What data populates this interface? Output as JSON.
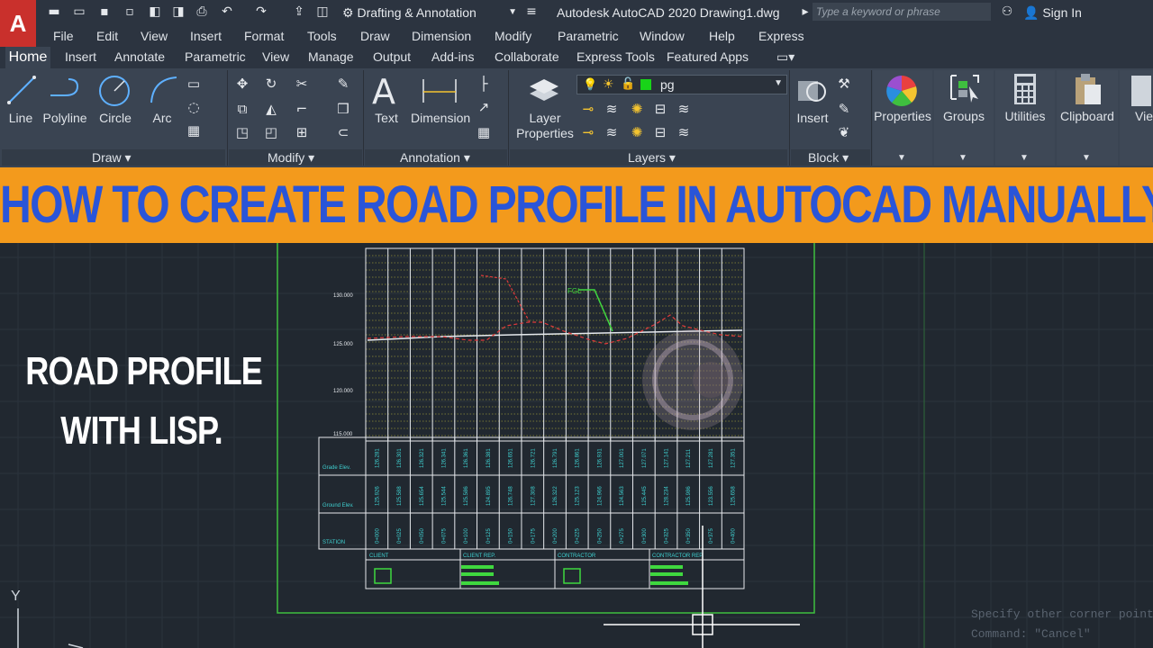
{
  "titlebar": {
    "app_logo": "A",
    "workspace": "Drafting & Annotation",
    "app_title": "Autodesk AutoCAD 2020    Drawing1.dwg",
    "search_placeholder": "Type a keyword or phrase",
    "sign_in": "Sign In"
  },
  "menu": [
    "File",
    "Edit",
    "View",
    "Insert",
    "Format",
    "Tools",
    "Draw",
    "Dimension",
    "Modify",
    "Parametric",
    "Window",
    "Help",
    "Express"
  ],
  "tabs": [
    "Home",
    "Insert",
    "Annotate",
    "Parametric",
    "View",
    "Manage",
    "Output",
    "Add-ins",
    "Collaborate",
    "Express Tools",
    "Featured Apps"
  ],
  "ribbon": {
    "draw_tools": [
      "Line",
      "Polyline",
      "Circle",
      "Arc"
    ],
    "panels": {
      "draw": "Draw",
      "modify": "Modify",
      "annotation": "Annotation",
      "layers": "Layers",
      "block": "Block"
    },
    "annotation_tools": [
      "Text",
      "Dimension"
    ],
    "layer_properties": "Layer\nProperties",
    "layer_current": "pg",
    "insert": "Insert",
    "right_tools": [
      "Properties",
      "Groups",
      "Utilities",
      "Clipboard",
      "Vie"
    ]
  },
  "banner": "HOW TO CREATE ROAD PROFILE IN AUTOCAD MANUALLY?",
  "overlay": {
    "line1": "ROAD PROFILE",
    "line2": "WITH LISP."
  },
  "drawing": {
    "elevations": [
      "130.000",
      "125.000",
      "120.000",
      "115.000"
    ],
    "row_labels": [
      "Grade Elev.",
      "Ground Elev.",
      "STATION"
    ],
    "footer_labels": [
      "CLIENT",
      "CLIENT REP.",
      "CONTRACTOR",
      "CONTRACTOR REP."
    ],
    "fgl_label": "FGL",
    "stations": [
      "0+000",
      "0+025",
      "0+050",
      "0+075",
      "0+100",
      "0+125",
      "0+150",
      "0+175",
      "0+200",
      "0+225",
      "0+250",
      "0+275",
      "0+300",
      "0+325",
      "0+350",
      "0+375",
      "0+400"
    ],
    "grade_elev": [
      "126.281",
      "126.301",
      "126.321",
      "126.341",
      "126.361",
      "126.381",
      "126.651",
      "126.721",
      "126.791",
      "126.861",
      "126.931",
      "127.001",
      "127.071",
      "127.141",
      "127.211",
      "127.281",
      "127.351"
    ],
    "ground_elev": [
      "125.926",
      "125.588",
      "125.654",
      "125.544",
      "125.586",
      "124.895",
      "126.748",
      "127.308",
      "126.322",
      "125.123",
      "124.966",
      "124.563",
      "125.445",
      "128.234",
      "125.986",
      "123.556",
      "125.658"
    ]
  },
  "command_line": {
    "line1": "Specify other corner point",
    "line2": "Command: \"Cancel\""
  },
  "colors": {
    "accent": "#c9302c",
    "banner_bg": "#f39a1c",
    "banner_text": "#2a55d8"
  }
}
